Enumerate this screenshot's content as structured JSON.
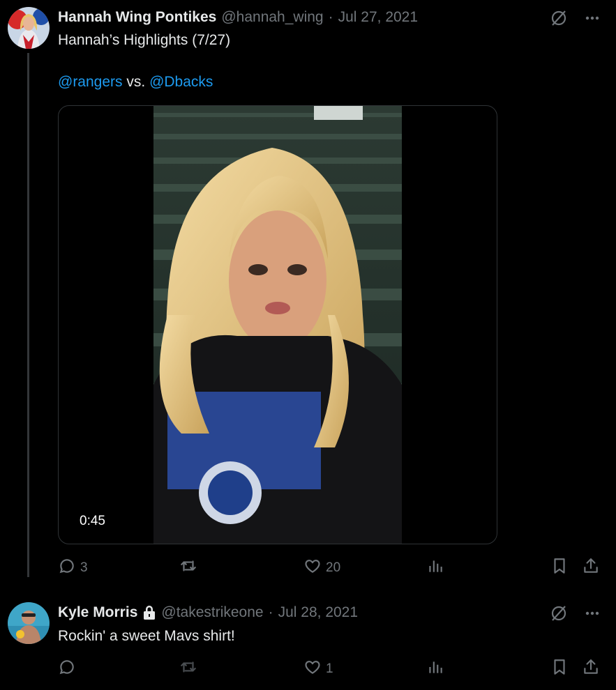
{
  "tweets": [
    {
      "author_name": "Hannah Wing Pontikes",
      "handle": "@hannah_wing",
      "date_sep": "·",
      "date": "Jul 27, 2021",
      "text_line1": "Hannah’s Highlights (7/27)",
      "mention1": "@rangers",
      "vs": "vs.",
      "mention2": "@Dbacks",
      "video_duration": "0:45",
      "replies": "3",
      "retweets": "",
      "likes": "20"
    },
    {
      "author_name": "Kyle Morris",
      "handle": "@takestrikeone",
      "date_sep": "·",
      "date": "Jul 28, 2021",
      "text": "Rockin' a sweet Mavs shirt!",
      "replies": "",
      "retweets": "",
      "likes": "1"
    }
  ],
  "icons": {
    "grok": "grok-slash-icon",
    "more": "more-dots-icon",
    "reply": "reply-bubble-icon",
    "retweet": "retweet-icon",
    "like": "heart-icon",
    "views": "views-bar-chart-icon",
    "bookmark": "bookmark-icon",
    "share": "share-upload-icon",
    "protected": "lock-icon"
  },
  "colors": {
    "background": "#000000",
    "text": "#e7e9ea",
    "muted": "#71767b",
    "link": "#1d9bf0",
    "border": "#2f3336"
  }
}
